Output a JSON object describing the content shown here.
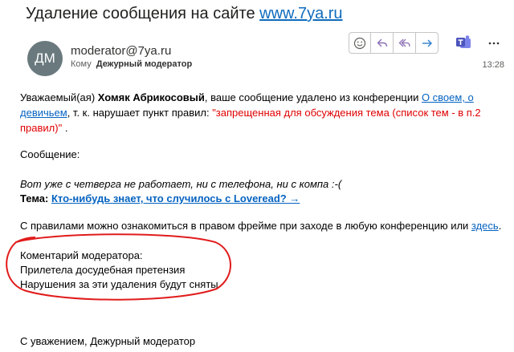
{
  "email": {
    "subject_prefix": "Удаление сообщения на сайте",
    "subject_link": "www.7ya.ru",
    "avatar_initials": "ДМ",
    "sender": "moderator@7ya.ru",
    "to_label": "Кому",
    "to_name": "Дежурный модератор",
    "time": "13:28"
  },
  "toolbar": {
    "emoji": "emoji-icon",
    "reply": "reply-icon",
    "reply_all": "reply-all-icon",
    "forward": "forward-icon",
    "teams": "teams-icon",
    "more": "more-icon"
  },
  "body": {
    "greeting_pre": "Уважаемый(ая) ",
    "user_name": "Хомяк Абрикосовый",
    "greeting_mid": ", ваше сообщение удалено из конференции ",
    "conference_link": "О своем, о девичьем",
    "greeting_post": ", т. к. нарушает пункт правил: ",
    "rule_text": "\"запрещенная для обсуждения тема (список тем - в п.2 правил)\"",
    "greeting_end": " .",
    "message_label": "Сообщение:",
    "quote": "Вот уже с четверга не работает, ни с телефона, ни с компа :-(",
    "topic_label": "Тема: ",
    "topic_link": "Кто-нибудь знает, что случилось с Loveread? →",
    "rules_pre": "С правилами можно ознакомиться в правом фрейме при заходе в любую конференцию или ",
    "rules_link": "здесь",
    "rules_post": ".",
    "comment_title": "Коментарий модератора:",
    "comment_line1": "Прилетела досудебная претензия",
    "comment_line2": "Нарушения за эти удаления будут сняты",
    "signature": "С уважением, Дежурный модератор"
  },
  "colors": {
    "link": "#0563c1",
    "rule_red": "#e00000",
    "annotation_red": "#e11b1b",
    "avatar": "#69797e",
    "action_icon": "#8a6fb3",
    "forward_icon": "#2f7fd0"
  }
}
